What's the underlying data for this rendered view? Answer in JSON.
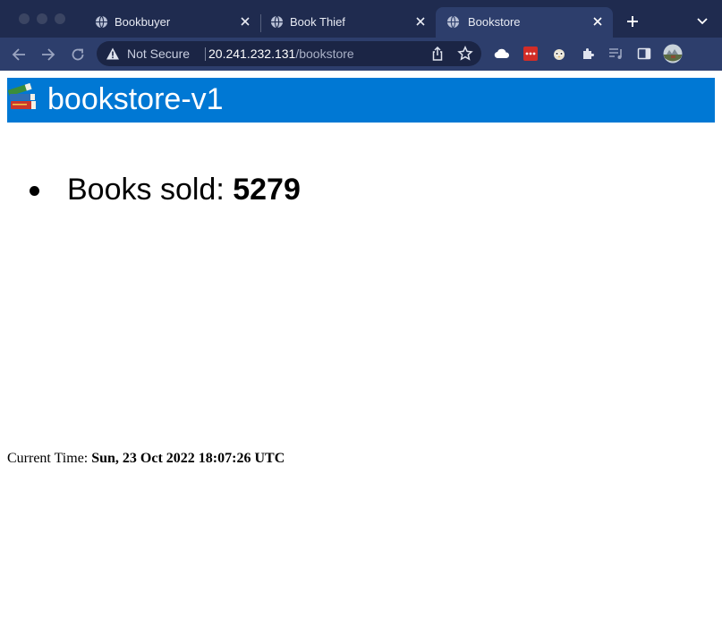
{
  "browser": {
    "tabs": [
      {
        "title": "Bookbuyer",
        "active": false
      },
      {
        "title": "Book Thief",
        "active": false
      },
      {
        "title": "Bookstore",
        "active": true
      }
    ],
    "address_bar": {
      "security_label": "Not Secure",
      "host": "20.241.232.131",
      "path": "/bookstore"
    },
    "icons": {
      "tab_favicon": "globe-icon",
      "new_tab": "plus-icon",
      "tab_menu": "chevron-down-icon",
      "back": "arrow-left-icon",
      "forward": "arrow-right-icon",
      "reload": "reload-icon",
      "security": "warning-icon",
      "share": "share-icon",
      "bookmark": "star-icon",
      "extensions": [
        "cloud-extension-icon",
        "lastpass-extension-icon",
        "owl-extension-icon",
        "puzzle-extensions-icon",
        "media-queue-icon",
        "side-panel-icon",
        "profile-avatar"
      ]
    },
    "colors": {
      "tabstrip": "#1f2b4f",
      "toolbar": "#2d3e6c"
    }
  },
  "page": {
    "banner": {
      "title": "bookstore-v1",
      "icon": "books-emoji-icon",
      "background": "#0078d4"
    },
    "stats": {
      "label": "Books sold: ",
      "value": "5279"
    },
    "time": {
      "label": "Current Time: ",
      "value": "Sun, 23 Oct 2022 18:07:26 UTC"
    }
  }
}
